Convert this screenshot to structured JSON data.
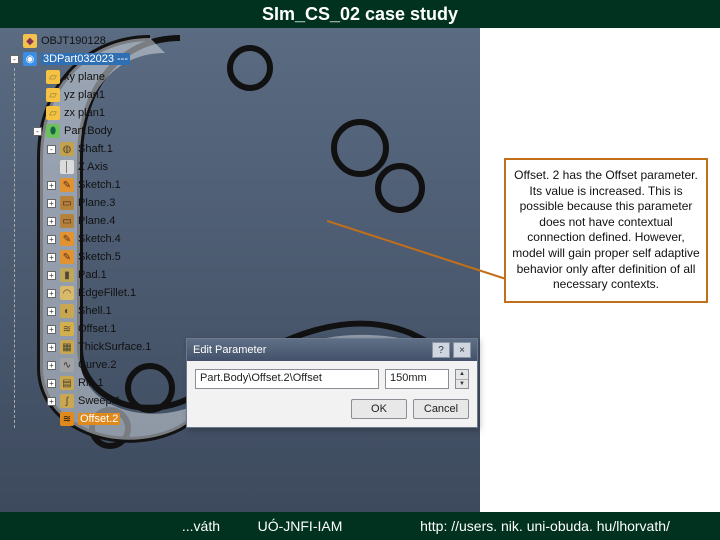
{
  "title": "SIm_CS_02 case study",
  "footer": {
    "author": "...váth",
    "org": "UÓ-JNFI-IAM",
    "url": "http: //users. nik. uni-obuda. hu/lhorvath/"
  },
  "tree": {
    "root1": "OBJT190128",
    "root2": "3DPart032023 ---",
    "items": [
      {
        "label": "xy plane",
        "icon": "plane"
      },
      {
        "label": "yz plan1",
        "icon": "plane"
      },
      {
        "label": "zx plan1",
        "icon": "plane"
      },
      {
        "label": "Part.Body",
        "icon": "body",
        "exp": "-"
      },
      {
        "label": "Shaft.1",
        "icon": "shaft",
        "indent": 2,
        "exp": "-"
      },
      {
        "label": "Z Axis",
        "icon": "axis",
        "indent": 2
      },
      {
        "label": "Sketch.1",
        "icon": "sk",
        "indent": 2,
        "exp": "+"
      },
      {
        "label": "Plane.3",
        "icon": "pln",
        "indent": 2,
        "exp": "+"
      },
      {
        "label": "Plane.4",
        "icon": "pln",
        "indent": 2,
        "exp": "+"
      },
      {
        "label": "Sketch.4",
        "icon": "sk",
        "indent": 2,
        "exp": "+"
      },
      {
        "label": "Sketch.5",
        "icon": "sk",
        "indent": 2,
        "exp": "+"
      },
      {
        "label": "Pad.1",
        "icon": "pad",
        "indent": 2,
        "exp": "+"
      },
      {
        "label": "EdgeFillet.1",
        "icon": "edge",
        "indent": 2,
        "exp": "+"
      },
      {
        "label": "Shell.1",
        "icon": "shell",
        "indent": 2,
        "exp": "+"
      },
      {
        "label": "Offset.1",
        "icon": "off",
        "indent": 2,
        "exp": "+"
      },
      {
        "label": "ThickSurface.1",
        "icon": "thk",
        "indent": 2,
        "exp": "+"
      },
      {
        "label": "Curve.2",
        "icon": "cur",
        "indent": 2,
        "exp": "+"
      },
      {
        "label": "Rib.1",
        "icon": "rib",
        "indent": 2,
        "exp": "+"
      },
      {
        "label": "Sweep.1",
        "icon": "swp",
        "indent": 2,
        "exp": "+"
      },
      {
        "label": "Offset.2",
        "icon": "sel",
        "indent": 2,
        "selected": true
      }
    ]
  },
  "dialog": {
    "title": "Edit Parameter",
    "help": "?",
    "close": "×",
    "param_path": "Part.Body\\Offset.2\\Offset",
    "param_value": "150mm",
    "ok": "OK",
    "cancel": "Cancel"
  },
  "note": "Offset. 2 has the Offset parameter. Its value is increased. This is possible because this parameter does not have contextual connection defined. However, model will gain proper self adaptive behavior only after definition of all necessary contexts."
}
